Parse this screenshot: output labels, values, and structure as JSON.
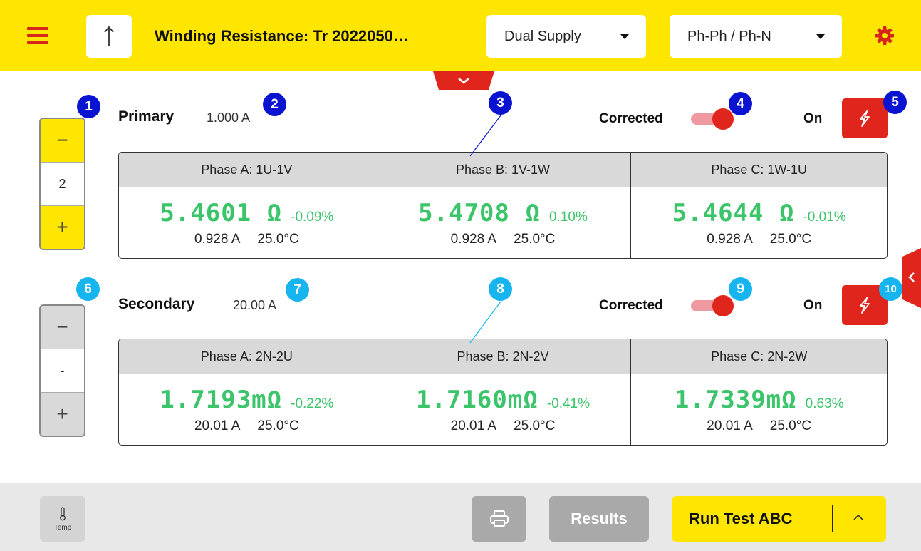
{
  "header": {
    "title": "Winding Resistance: Tr 2022050…",
    "supply_mode": "Dual Supply",
    "connection_mode": "Ph-Ph / Ph-N",
    "brand_color": "#ffe600",
    "accent_color": "#e0261c"
  },
  "primary": {
    "label": "Primary",
    "current": "1.000 A",
    "corrected_label": "Corrected",
    "corrected_on": true,
    "on_label": "On",
    "stepper_value": "2",
    "phases": [
      {
        "header": "Phase A: 1U-1V",
        "value": "5.4601",
        "unit": "Ω",
        "deviation": "-0.09%",
        "current": "0.928 A",
        "temp": "25.0°C"
      },
      {
        "header": "Phase B: 1V-1W",
        "value": "5.4708",
        "unit": "Ω",
        "deviation": "0.10%",
        "current": "0.928 A",
        "temp": "25.0°C"
      },
      {
        "header": "Phase C: 1W-1U",
        "value": "5.4644",
        "unit": "Ω",
        "deviation": "-0.01%",
        "current": "0.928 A",
        "temp": "25.0°C"
      }
    ]
  },
  "secondary": {
    "label": "Secondary",
    "current": "20.00 A",
    "corrected_label": "Corrected",
    "corrected_on": true,
    "on_label": "On",
    "stepper_value": "-",
    "phases": [
      {
        "header": "Phase A: 2N-2U",
        "value": "1.7193",
        "unit": "mΩ",
        "deviation": "-0.22%",
        "current": "20.01 A",
        "temp": "25.0°C"
      },
      {
        "header": "Phase B: 2N-2V",
        "value": "1.7160",
        "unit": "mΩ",
        "deviation": "-0.41%",
        "current": "20.01 A",
        "temp": "25.0°C"
      },
      {
        "header": "Phase C: 2N-2W",
        "value": "1.7339",
        "unit": "mΩ",
        "deviation": "0.63%",
        "current": "20.01 A",
        "temp": "25.0°C"
      }
    ]
  },
  "stepper": {
    "minus": "−",
    "plus": "+"
  },
  "badges": [
    "1",
    "2",
    "3",
    "4",
    "5",
    "6",
    "7",
    "8",
    "9",
    "10"
  ],
  "footer": {
    "temp_label": "Temp",
    "results_label": "Results",
    "run_label": "Run Test ABC"
  },
  "icons": [
    "hamburger-menu-icon",
    "arrow-up-icon",
    "gear-icon",
    "chevron-down-icon",
    "chevron-left-icon",
    "lightning-icon",
    "thermometer-icon",
    "printer-icon",
    "chevron-up-icon"
  ]
}
